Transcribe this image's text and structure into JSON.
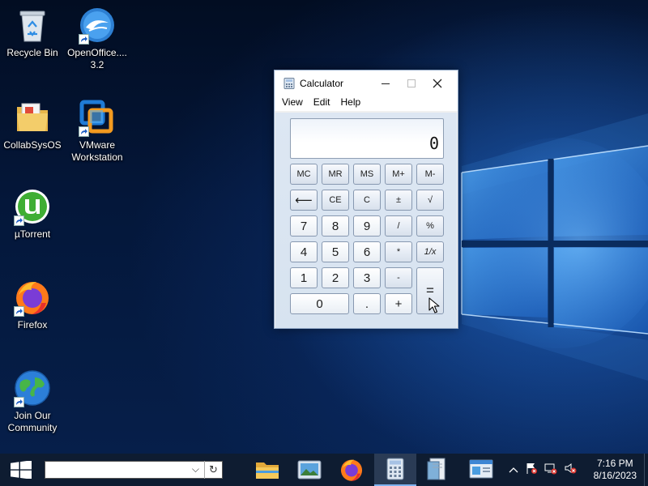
{
  "desktop": {
    "icons": [
      {
        "label": "Recycle Bin",
        "icon": "recycle-bin-icon"
      },
      {
        "label": "OpenOffice.... 3.2",
        "icon": "openoffice-icon"
      },
      {
        "label": "CollabSysOS",
        "icon": "folder-icon"
      },
      {
        "label": "VMware Workstation",
        "icon": "vmware-icon"
      },
      {
        "label": "µTorrent",
        "icon": "utorrent-icon"
      },
      {
        "label": "Firefox",
        "icon": "firefox-icon"
      },
      {
        "label": "Join Our Community",
        "icon": "globe-icon"
      }
    ]
  },
  "calculator": {
    "title": "Calculator",
    "menu": [
      "View",
      "Edit",
      "Help"
    ],
    "display": "0",
    "buttons": {
      "mc": "MC",
      "mr": "MR",
      "ms": "MS",
      "mplus": "M+",
      "mminus": "M-",
      "back": "⟵",
      "ce": "CE",
      "c": "C",
      "plusminus": "±",
      "sqrt": "√",
      "n7": "7",
      "n8": "8",
      "n9": "9",
      "div": "/",
      "pct": "%",
      "n4": "4",
      "n5": "5",
      "n6": "6",
      "mul": "*",
      "recip": "1/x",
      "n1": "1",
      "n2": "2",
      "n3": "3",
      "sub": "-",
      "eq": "=",
      "n0": "0",
      "dot": ".",
      "add": "+"
    }
  },
  "taskbar": {
    "search_value": "",
    "apps": [
      {
        "name": "file-explorer",
        "state": "normal"
      },
      {
        "name": "photos",
        "state": "normal"
      },
      {
        "name": "firefox",
        "state": "normal"
      },
      {
        "name": "calculator",
        "state": "active"
      },
      {
        "name": "notepad-document",
        "state": "normal"
      },
      {
        "name": "control-panel",
        "state": "normal"
      }
    ],
    "clock": {
      "time": "7:16 PM",
      "date": "8/16/2023"
    }
  },
  "colors": {
    "accent": "#7fb2ef",
    "taskbar": "#0e1c31",
    "desktop": "#061a3a"
  }
}
